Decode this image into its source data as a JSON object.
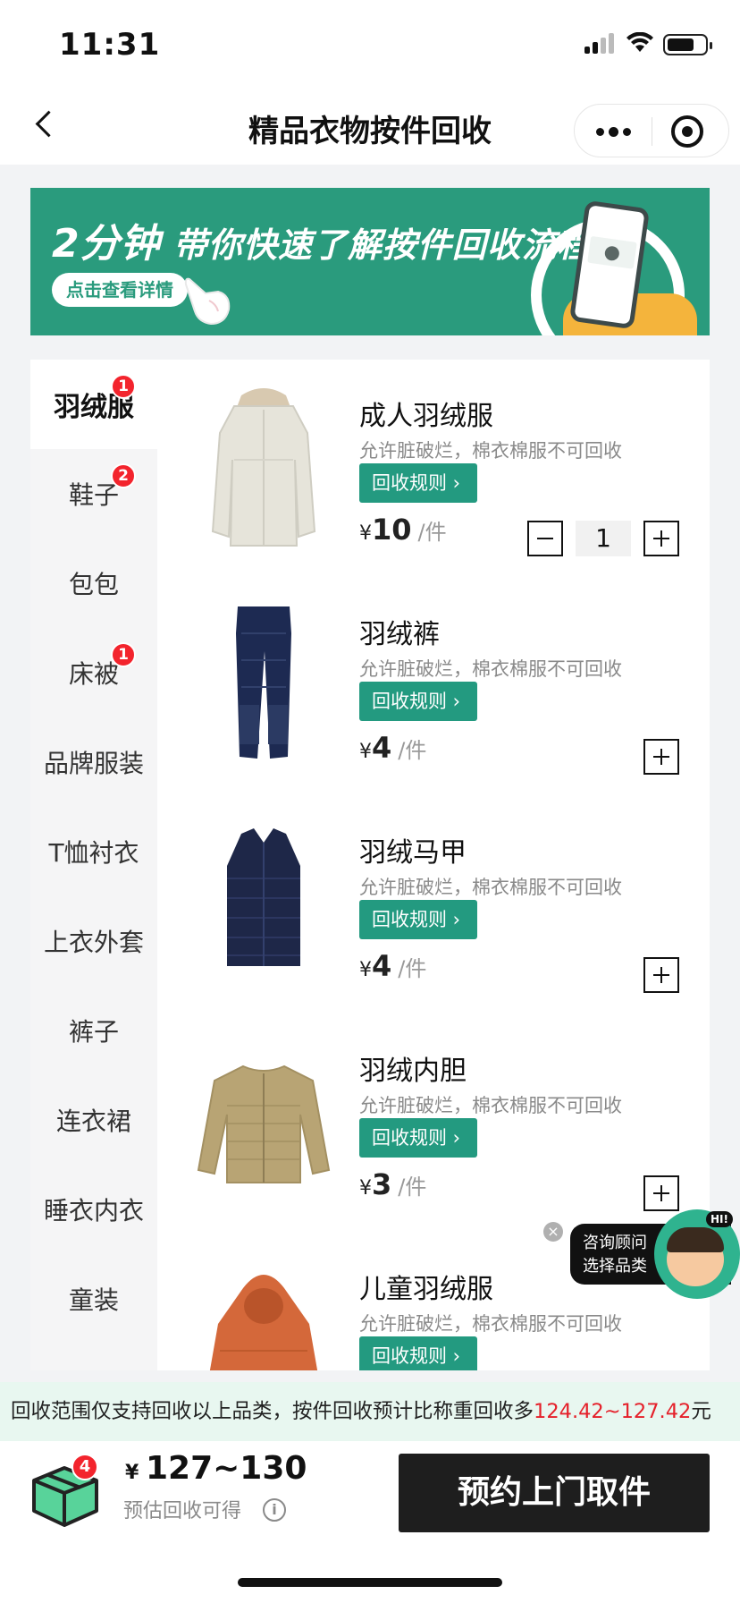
{
  "status_bar": {
    "time": "11:31"
  },
  "header": {
    "title": "精品衣物按件回收"
  },
  "banner": {
    "headline_big": "2分钟",
    "headline": "带你快速了解按件回收流程",
    "cta": "点击查看详情"
  },
  "sidebar": {
    "items": [
      {
        "label": "羽绒服",
        "badge": "1",
        "active": true
      },
      {
        "label": "鞋子",
        "badge": "2"
      },
      {
        "label": "包包"
      },
      {
        "label": "床被",
        "badge": "1"
      },
      {
        "label": "品牌服装"
      },
      {
        "label": "T恤衬衣"
      },
      {
        "label": "上衣外套"
      },
      {
        "label": "裤子"
      },
      {
        "label": "连衣裙"
      },
      {
        "label": "睡衣内衣"
      },
      {
        "label": "童装"
      }
    ]
  },
  "products": [
    {
      "name": "成人羽绒服",
      "desc": "允许脏破烂，棉衣棉服不可回收",
      "rule_label": "回收规则 ›",
      "currency": "¥",
      "price": "10",
      "unit": "/件",
      "quantity": "1"
    },
    {
      "name": "羽绒裤",
      "desc": "允许脏破烂，棉衣棉服不可回收",
      "rule_label": "回收规则 ›",
      "currency": "¥",
      "price": "4",
      "unit": "/件"
    },
    {
      "name": "羽绒马甲",
      "desc": "允许脏破烂，棉衣棉服不可回收",
      "rule_label": "回收规则 ›",
      "currency": "¥",
      "price": "4",
      "unit": "/件"
    },
    {
      "name": "羽绒内胆",
      "desc": "允许脏破烂，棉衣棉服不可回收",
      "rule_label": "回收规则 ›",
      "currency": "¥",
      "price": "3",
      "unit": "/件"
    },
    {
      "name": "儿童羽绒服",
      "desc": "允许脏破烂，棉衣棉服不可回收",
      "rule_label": "回收规则 ›"
    }
  ],
  "consult": {
    "line1": "咨询顾问",
    "line2": "选择品类",
    "hi": "HI!"
  },
  "notice": {
    "text": "回收范围仅支持回收以上品类，按件回收预计比称重回收多",
    "range": "124.42~127.42",
    "suffix": "元"
  },
  "footer": {
    "cart_count": "4",
    "currency": "¥",
    "total": "127~130",
    "estimate_label": "预估回收可得",
    "book_button": "预约上门取件"
  },
  "colors": {
    "accent": "#239a80",
    "badge": "#f3242d",
    "notice_bg": "#e8f7f0",
    "range_text": "#e5202a"
  }
}
